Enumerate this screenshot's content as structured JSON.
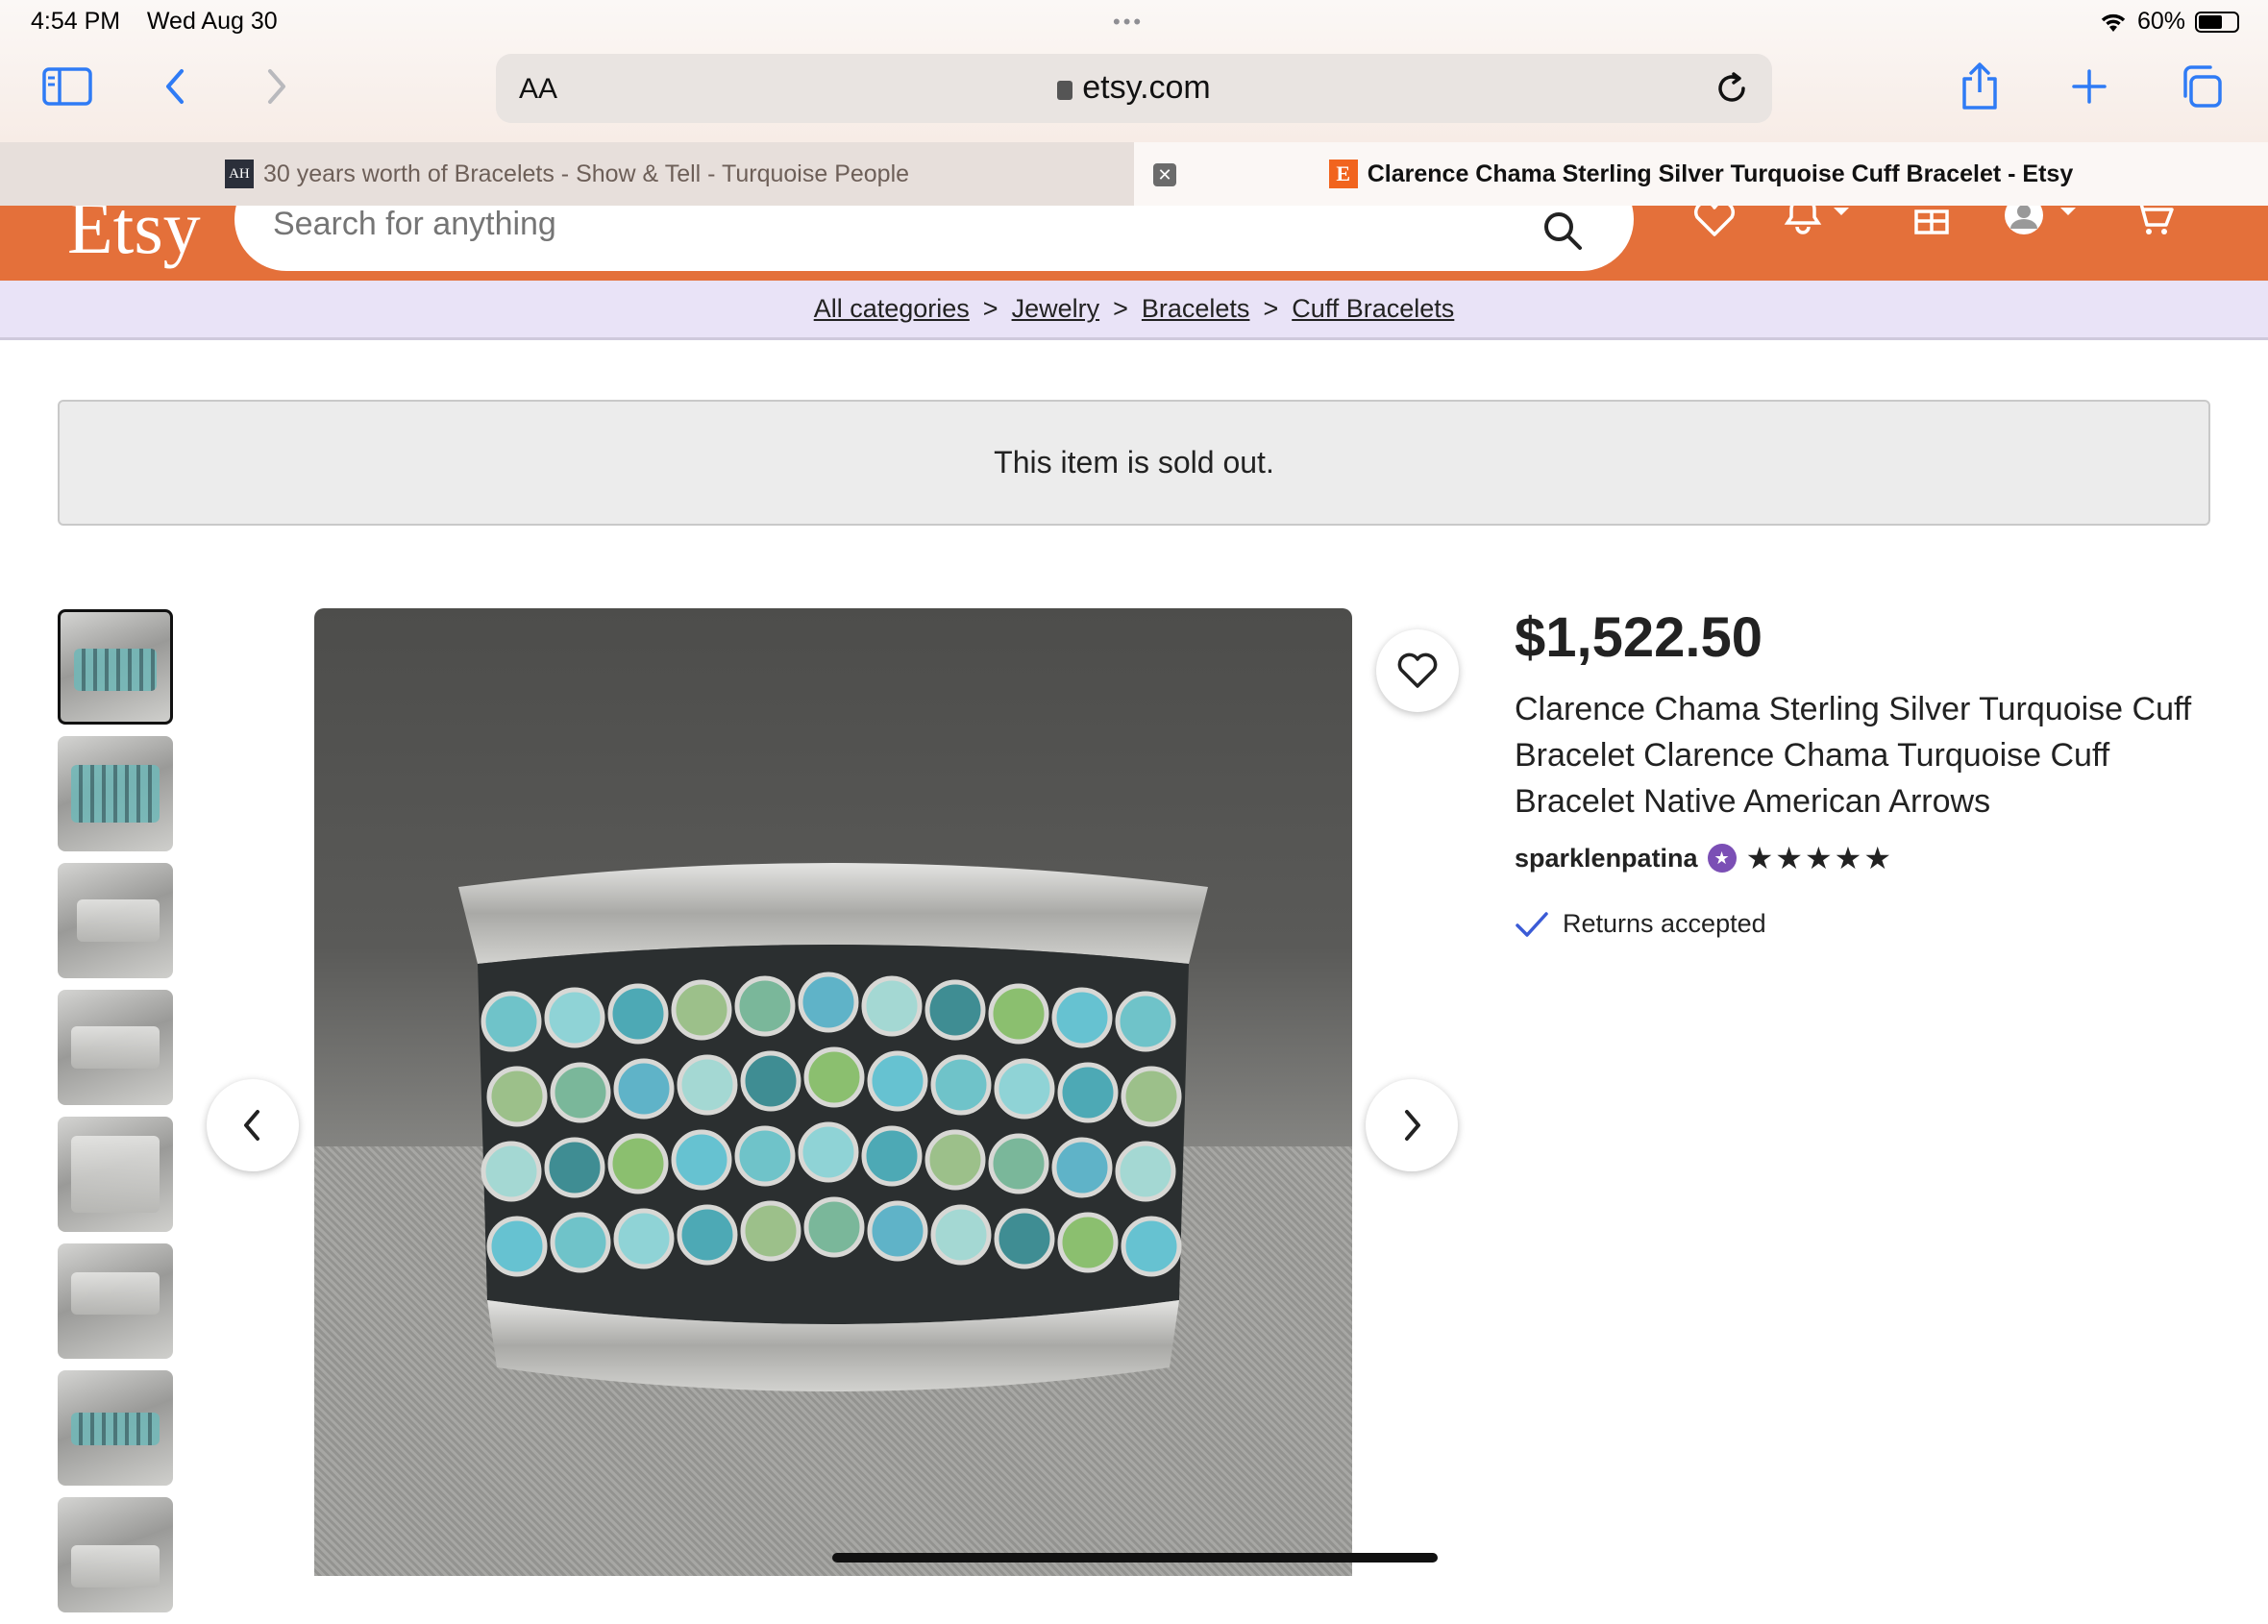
{
  "status": {
    "time": "4:54 PM",
    "date": "Wed Aug 30",
    "battery": "60%"
  },
  "browser": {
    "address_text_size_label": "AA",
    "url": "etsy.com",
    "tabs": [
      {
        "label": "30 years worth of Bracelets - Show & Tell - Turquoise People",
        "favicon": "AH"
      },
      {
        "label": "Clarence Chama Sterling Silver Turquoise Cuff Bracelet - Etsy",
        "favicon": "E"
      }
    ]
  },
  "etsy": {
    "logo": "Etsy",
    "search_placeholder": "Search for anything"
  },
  "breadcrumb": [
    "All categories",
    "Jewelry",
    "Bracelets",
    "Cuff Bracelets"
  ],
  "notice": "This item is sold out.",
  "listing": {
    "price": "$1,522.50",
    "title": "Clarence Chama Sterling Silver Turquoise Cuff Bracelet Clarence Chama Turquoise Cuff Bracelet Native American Arrows",
    "seller": "sparklenpatina",
    "rating_stars": "★★★★★",
    "rating": 5,
    "returns": "Returns accepted"
  },
  "colors": {
    "etsy_orange": "#e4703a",
    "breadcrumb_bg": "#e9e3f7",
    "star_seller": "#7b4fb5",
    "check": "#3b5bd6"
  }
}
